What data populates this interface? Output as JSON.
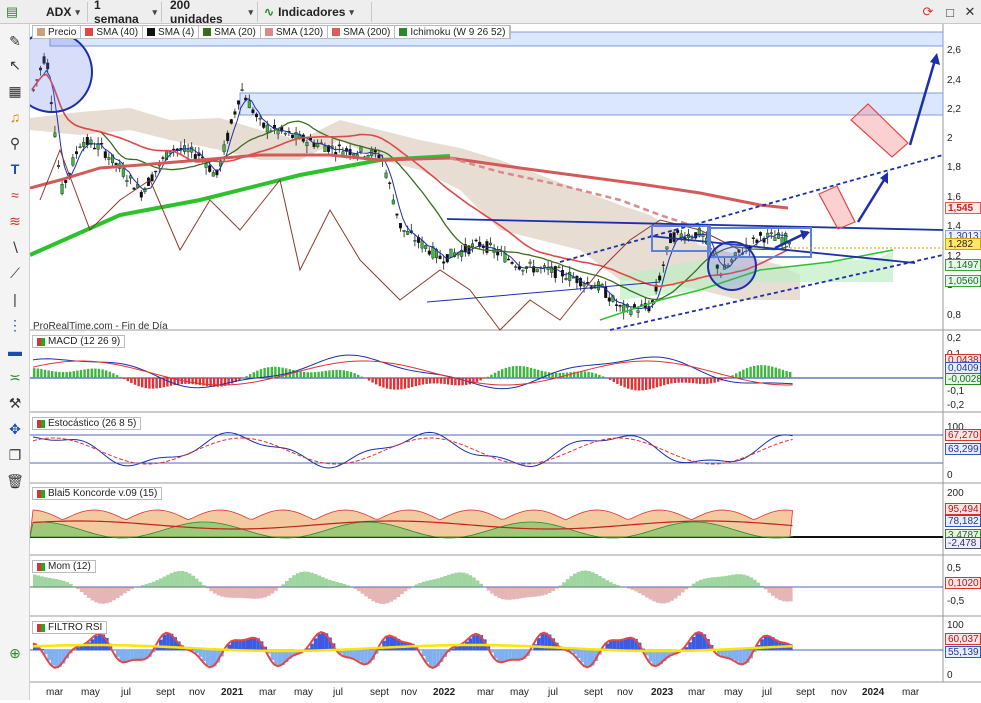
{
  "toolbar": {
    "symbol": "ADX",
    "timeframe": "1 semana",
    "units": "200 unidades",
    "indicators": "Indicadores"
  },
  "legend": [
    {
      "label": "Precio",
      "color": "#c8a27a"
    },
    {
      "label": "SMA (40)",
      "color": "#e04848"
    },
    {
      "label": "SMA (4)",
      "color": "#111111"
    },
    {
      "label": "SMA (20)",
      "color": "#3a6d1f"
    },
    {
      "label": "SMA (120)",
      "color": "#d98a8a"
    },
    {
      "label": "SMA (200)",
      "color": "#e05c5c"
    },
    {
      "label": "Ichimoku (W 9 26 52)",
      "color": "#2a8a2a"
    }
  ],
  "price_axis": {
    "ticks": [
      "2,6",
      "2,4",
      "2,2",
      "2",
      "1,8",
      "1,6",
      "1,4",
      "1,2",
      "1",
      "0,8"
    ],
    "tags": {
      "t1": "1,545",
      "t2": "1,3013",
      "t3": "1,282",
      "t4": "1,1497",
      "t5": "1,0560"
    }
  },
  "watermark": "ProRealTime.com - Fin de Día",
  "panes": {
    "macd": {
      "label": "MACD (12 26 9)",
      "ticks": [
        "0,2",
        "0,1",
        "-0,1",
        "-0,2"
      ],
      "tags": [
        "0,0438",
        "0,0409",
        "-0,0028"
      ]
    },
    "stoch": {
      "label": "Estocástico (26 8 5)",
      "ticks": [
        "100",
        "50",
        "0"
      ],
      "tags": [
        "67,270",
        "63,299"
      ]
    },
    "koncorde": {
      "label": "Blai5 Koncorde v.09 (15)",
      "ticks": [
        "200",
        "100",
        "0"
      ],
      "tags": [
        "95,494",
        "78,182",
        "3,4787",
        "-2,478"
      ]
    },
    "mom": {
      "label": "Mom (12)",
      "ticks": [
        "0,5",
        "-0,5"
      ],
      "tags": [
        "0,1020"
      ]
    },
    "rsi": {
      "label": "FILTRO RSI",
      "ticks": [
        "100",
        "50",
        "0"
      ],
      "tags": [
        "60,037",
        "55,139"
      ]
    }
  },
  "x_axis": [
    "mar",
    "may",
    "jul",
    "sept",
    "nov",
    "2021",
    "mar",
    "may",
    "jul",
    "sept",
    "nov",
    "2022",
    "mar",
    "may",
    "jul",
    "sept",
    "nov",
    "2023",
    "mar",
    "may",
    "jul",
    "sept",
    "nov",
    "2024",
    "mar"
  ],
  "icons": {
    "toolbar": [
      "candlestick-chart-icon",
      "chevron-down-icon",
      "refresh-icon",
      "restore-icon",
      "close-icon"
    ],
    "tools": [
      "pencil-icon",
      "pointer-icon",
      "ruler-icon",
      "trash-icon",
      "zoom-icon",
      "text-icon"
    ]
  }
}
